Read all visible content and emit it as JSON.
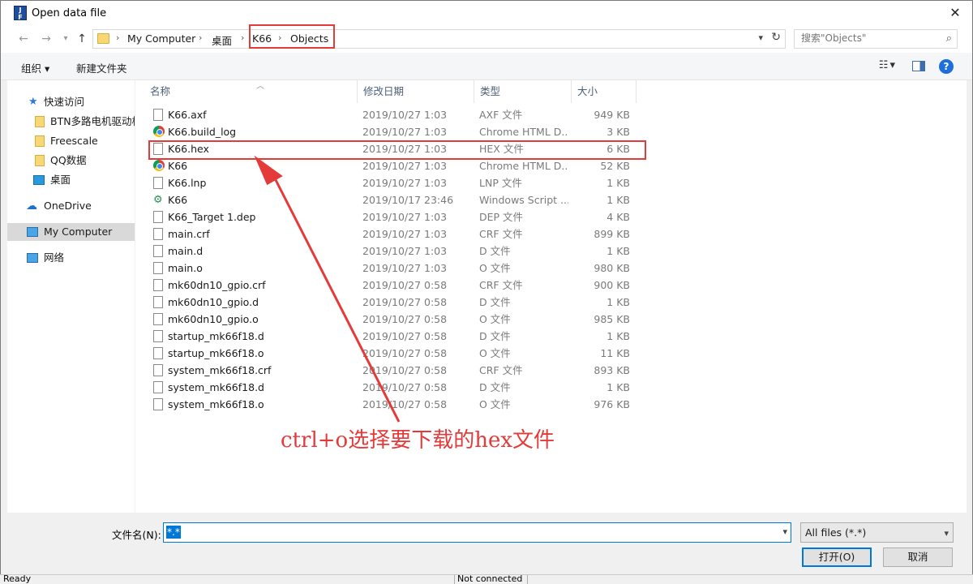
{
  "window": {
    "title": "Open data file",
    "app_icon_text": "J\nFLASH"
  },
  "address": {
    "crumbs": [
      "My Computer",
      "桌面",
      "K66",
      "Objects"
    ],
    "search_placeholder": "搜索\"Objects\""
  },
  "toolbar": {
    "organize": "组织 ▾",
    "new_folder": "新建文件夹"
  },
  "nav_pane": {
    "items": [
      {
        "label": "快速访问",
        "icon": "star-icon"
      },
      {
        "label": "BTN多路电机驱动板",
        "icon": "folder-icon"
      },
      {
        "label": "Freescale",
        "icon": "folder-icon"
      },
      {
        "label": "QQ数据",
        "icon": "folder-icon"
      },
      {
        "label": "桌面",
        "icon": "desktop-icon"
      },
      {
        "label": "OneDrive",
        "icon": "cloud-icon"
      },
      {
        "label": "My Computer",
        "icon": "computer-icon",
        "selected": true
      },
      {
        "label": "网络",
        "icon": "network-icon"
      }
    ]
  },
  "file_list": {
    "columns": [
      "名称",
      "修改日期",
      "类型",
      "大小"
    ],
    "rows": [
      {
        "name": "K66.axf",
        "date": "2019/10/27 1:03",
        "type": "AXF 文件",
        "size": "949 KB",
        "icon": "file-icon"
      },
      {
        "name": "K66.build_log",
        "date": "2019/10/27 1:03",
        "type": "Chrome HTML D...",
        "size": "3 KB",
        "icon": "chrome-icon"
      },
      {
        "name": "K66.hex",
        "date": "2019/10/27 1:03",
        "type": "HEX 文件",
        "size": "6 KB",
        "icon": "file-icon"
      },
      {
        "name": "K66",
        "date": "2019/10/27 1:03",
        "type": "Chrome HTML D...",
        "size": "52 KB",
        "icon": "chrome-icon"
      },
      {
        "name": "K66.lnp",
        "date": "2019/10/27 1:03",
        "type": "LNP 文件",
        "size": "1 KB",
        "icon": "file-icon"
      },
      {
        "name": "K66",
        "date": "2019/10/17 23:46",
        "type": "Windows Script ...",
        "size": "1 KB",
        "icon": "script-icon"
      },
      {
        "name": "K66_Target 1.dep",
        "date": "2019/10/27 1:03",
        "type": "DEP 文件",
        "size": "4 KB",
        "icon": "file-icon"
      },
      {
        "name": "main.crf",
        "date": "2019/10/27 1:03",
        "type": "CRF 文件",
        "size": "899 KB",
        "icon": "file-icon"
      },
      {
        "name": "main.d",
        "date": "2019/10/27 1:03",
        "type": "D 文件",
        "size": "1 KB",
        "icon": "file-icon"
      },
      {
        "name": "main.o",
        "date": "2019/10/27 1:03",
        "type": "O 文件",
        "size": "980 KB",
        "icon": "file-icon"
      },
      {
        "name": "mk60dn10_gpio.crf",
        "date": "2019/10/27 0:58",
        "type": "CRF 文件",
        "size": "900 KB",
        "icon": "file-icon"
      },
      {
        "name": "mk60dn10_gpio.d",
        "date": "2019/10/27 0:58",
        "type": "D 文件",
        "size": "1 KB",
        "icon": "file-icon"
      },
      {
        "name": "mk60dn10_gpio.o",
        "date": "2019/10/27 0:58",
        "type": "O 文件",
        "size": "985 KB",
        "icon": "file-icon"
      },
      {
        "name": "startup_mk66f18.d",
        "date": "2019/10/27 0:58",
        "type": "D 文件",
        "size": "1 KB",
        "icon": "file-icon"
      },
      {
        "name": "startup_mk66f18.o",
        "date": "2019/10/27 0:58",
        "type": "O 文件",
        "size": "11 KB",
        "icon": "file-icon"
      },
      {
        "name": "system_mk66f18.crf",
        "date": "2019/10/27 0:58",
        "type": "CRF 文件",
        "size": "893 KB",
        "icon": "file-icon"
      },
      {
        "name": "system_mk66f18.d",
        "date": "2019/10/27 0:58",
        "type": "D 文件",
        "size": "1 KB",
        "icon": "file-icon"
      },
      {
        "name": "system_mk66f18.o",
        "date": "2019/10/27 0:58",
        "type": "O 文件",
        "size": "976 KB",
        "icon": "file-icon"
      }
    ]
  },
  "annotation": {
    "text": "ctrl+o选择要下载的hex文件",
    "color": "#e53a3a"
  },
  "bottom": {
    "filename_label": "文件名(N):",
    "filename_value": "*.*",
    "filter_value": "All files (*.*)",
    "open_button": "打开(O)",
    "cancel_button": "取消"
  },
  "statusbar": {
    "left": "Ready",
    "middle": "Not connected"
  }
}
